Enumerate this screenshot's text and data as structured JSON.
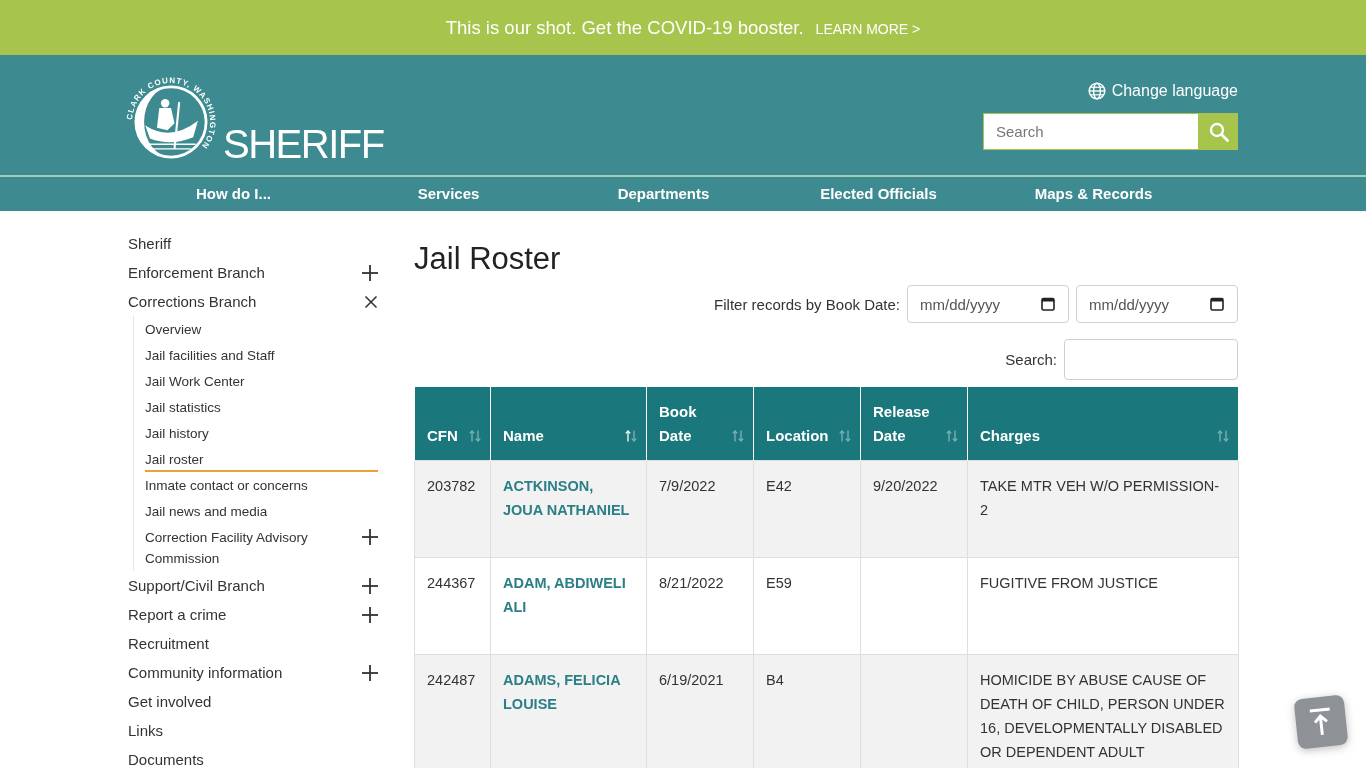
{
  "banner": {
    "message": "This is our shot. Get the COVID-19 booster.",
    "link_text": "LEARN MORE >"
  },
  "header": {
    "seal_text": "CLARK COUNTY, WASHINGTON",
    "site_title": "SHERIFF",
    "language_link": "Change language",
    "search": {
      "placeholder": "Search"
    }
  },
  "nav": [
    "How do I...",
    "Services",
    "Departments",
    "Elected Officials",
    "Maps & Records"
  ],
  "sidebar": {
    "items": [
      {
        "label": "Sheriff",
        "selected": false
      },
      {
        "label": "Enforcement Branch",
        "selected": false,
        "expanded": false
      },
      {
        "label": "Corrections Branch",
        "selected": false,
        "expanded": true,
        "children": [
          {
            "label": "Overview",
            "selected": false
          },
          {
            "label": "Jail facilities and Staff",
            "selected": false
          },
          {
            "label": "Jail Work Center",
            "selected": false
          },
          {
            "label": "Jail statistics",
            "selected": false
          },
          {
            "label": "Jail history",
            "selected": false
          },
          {
            "label": "Jail roster",
            "selected": true
          },
          {
            "label": "Inmate contact or concerns",
            "selected": false
          },
          {
            "label": "Jail news and media",
            "selected": false
          },
          {
            "label": "Correction Facility Advisory Commission",
            "selected": false,
            "expanded": false
          }
        ]
      },
      {
        "label": "Support/Civil Branch",
        "selected": false,
        "expanded": false
      },
      {
        "label": "Report a crime",
        "selected": false,
        "expanded": false
      },
      {
        "label": "Recruitment",
        "selected": false
      },
      {
        "label": "Community information",
        "selected": false,
        "expanded": false
      },
      {
        "label": "Get involved",
        "selected": false
      },
      {
        "label": "Links",
        "selected": false
      },
      {
        "label": "Documents",
        "selected": false
      }
    ]
  },
  "main": {
    "title": "Jail Roster",
    "date_filter": {
      "label": "Filter records by Book Date:",
      "fields": [
        {
          "placeholder": "mm/dd/yyyy"
        },
        {
          "placeholder": "mm/dd/yyyy"
        }
      ]
    },
    "search": {
      "label": "Search:"
    },
    "table": {
      "columns": [
        {
          "label": "CFN",
          "sorted": false
        },
        {
          "label": "Name",
          "sorted": true
        },
        {
          "label": "Book Date",
          "sorted": false
        },
        {
          "label": "Location",
          "sorted": false
        },
        {
          "label": "Release Date",
          "sorted": false
        },
        {
          "label": "Charges",
          "sorted": false
        }
      ],
      "rows": [
        {
          "cfn": "203782",
          "name": "ACTKINSON, JOUA NATHANIEL",
          "book_date": "7/9/2022",
          "location": "E42",
          "release_date": "9/20/2022",
          "charges": "TAKE MTR VEH W/O PERMISSION-2"
        },
        {
          "cfn": "244367",
          "name": "ADAM, ABDIWELI ALI",
          "book_date": "8/21/2022",
          "location": "E59",
          "charges": "FUGITIVE FROM JUSTICE"
        },
        {
          "cfn": "242487",
          "name": "ADAMS, FELICIA LOUISE",
          "book_date": "6/19/2021",
          "location": "B4",
          "charges": "HOMICIDE BY ABUSE CAUSE OF DEATH OF CHILD, PERSON UNDER 16, DEVELOPMENTALLY DISABLED OR DEPENDENT ADULT"
        }
      ]
    }
  }
}
